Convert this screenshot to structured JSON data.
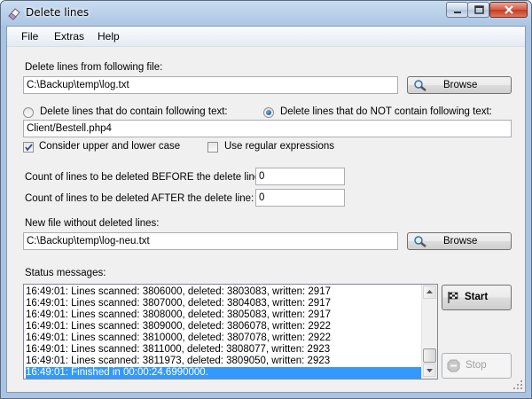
{
  "window": {
    "title": "Delete lines"
  },
  "menu": {
    "items": [
      "File",
      "Extras",
      "Help"
    ]
  },
  "source": {
    "label": "Delete lines from following file:",
    "value": "C:\\Backup\\temp\\log.txt",
    "browse_label": "Browse"
  },
  "mode": {
    "option_contain": "Delete lines that do contain following text:",
    "option_not_contain": "Delete lines that do NOT contain following text:",
    "selected": "not_contain",
    "text_value": "Client/Bestell.php4"
  },
  "options": {
    "case_label": "Consider upper and lower case",
    "case_checked": true,
    "regex_label": "Use regular expressions",
    "regex_checked": false
  },
  "counts": {
    "before_label": "Count of lines to be deleted BEFORE the delete line:",
    "before_value": "0",
    "after_label": "Count of lines to be deleted AFTER the delete line:",
    "after_value": "0"
  },
  "target": {
    "label": "New file without deleted lines:",
    "value": "C:\\Backup\\temp\\log-neu.txt",
    "browse_label": "Browse"
  },
  "status": {
    "label": "Status messages:",
    "lines": [
      "16:49:01: Lines scanned: 3806000, deleted: 3803083, written: 2917",
      "16:49:01: Lines scanned: 3807000, deleted: 3804083, written: 2917",
      "16:49:01: Lines scanned: 3808000, deleted: 3805083, written: 2917",
      "16:49:01: Lines scanned: 3809000, deleted: 3806078, written: 2922",
      "16:49:01: Lines scanned: 3810000, deleted: 3807078, written: 2922",
      "16:49:01: Lines scanned: 3811000, deleted: 3808077, written: 2923",
      "16:49:01: Lines scanned: 3811973, deleted: 3809050, written: 2923",
      "16:49:01: Finished in 00:00:24.6990000."
    ],
    "selected_index": 7
  },
  "actions": {
    "start_label": "Start",
    "stop_label": "Stop"
  },
  "icons": {
    "app": "eraser-icon",
    "start": "checkered-flag-icon",
    "stop": "stop-sign-icon",
    "browse": "magnifier-icon"
  }
}
